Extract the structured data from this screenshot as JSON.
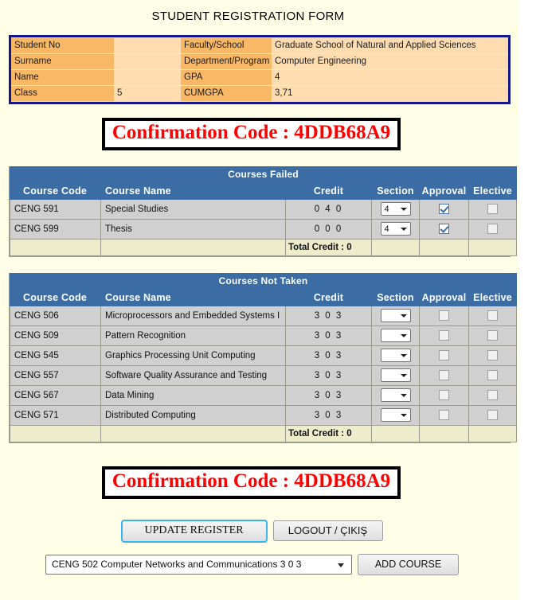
{
  "page": {
    "title": "STUDENT REGISTRATION FORM",
    "background_color": "#FFFFE8"
  },
  "student_info": {
    "border_color": "#13168C",
    "label_bg": "#F9B866",
    "value_bg": "#FFDDB0",
    "rows": [
      {
        "label_left": "Student No",
        "value_left": "",
        "label_right": "Faculty/School",
        "value_right": "Graduate School of Natural and Applied Sciences"
      },
      {
        "label_left": "Surname",
        "value_left": "",
        "label_right": "Department/Program",
        "value_right": "Computer Engineering"
      },
      {
        "label_left": "Name",
        "value_left": "",
        "label_right": "GPA",
        "value_right": "4"
      },
      {
        "label_left": "Class",
        "value_left": "5",
        "label_right": "CUMGPA",
        "value_right": "3,71"
      }
    ]
  },
  "confirmation": {
    "text": "Confirmation Code : 4DDB68A9",
    "code": "4DDB68A9",
    "text_color": "#FF0000",
    "border_color": "#000000"
  },
  "courses_failed": {
    "title": "Courses Failed",
    "header_bg": "#3B6DA4",
    "columns": [
      "Course Code",
      "Course Name",
      "Credit",
      "Section",
      "Approval",
      "Elective"
    ],
    "rows": [
      {
        "code": "CENG 591",
        "name": "Special Studies",
        "credit": "0 4 0",
        "section": "4",
        "approval_checked": true,
        "approval_disabled": true,
        "elective_checked": false,
        "elective_disabled": true
      },
      {
        "code": "CENG 599",
        "name": "Thesis",
        "credit": "0 0 0",
        "section": "4",
        "approval_checked": true,
        "approval_disabled": true,
        "elective_checked": false,
        "elective_disabled": true
      }
    ],
    "total_credit_label": "Total Credit : 0"
  },
  "courses_not_taken": {
    "title": "Courses Not Taken",
    "header_bg": "#3B6DA4",
    "columns": [
      "Course Code",
      "Course Name",
      "Credit",
      "Section",
      "Approval",
      "Elective"
    ],
    "rows": [
      {
        "code": "CENG 506",
        "name": "Microprocessors and Embedded Systems I",
        "credit": "3 0 3",
        "section": "",
        "approval_checked": false,
        "approval_disabled": true,
        "elective_checked": false,
        "elective_disabled": true
      },
      {
        "code": "CENG 509",
        "name": "Pattern Recognition",
        "credit": "3 0 3",
        "section": "",
        "approval_checked": false,
        "approval_disabled": true,
        "elective_checked": false,
        "elective_disabled": true
      },
      {
        "code": "CENG 545",
        "name": "Graphics Processing Unit Computing",
        "credit": "3 0 3",
        "section": "",
        "approval_checked": false,
        "approval_disabled": true,
        "elective_checked": false,
        "elective_disabled": true
      },
      {
        "code": "CENG 557",
        "name": "Software Quality Assurance and Testing",
        "credit": "3 0 3",
        "section": "",
        "approval_checked": false,
        "approval_disabled": true,
        "elective_checked": false,
        "elective_disabled": true
      },
      {
        "code": "CENG 567",
        "name": "Data Mining",
        "credit": "3 0 3",
        "section": "",
        "approval_checked": false,
        "approval_disabled": true,
        "elective_checked": false,
        "elective_disabled": true
      },
      {
        "code": "CENG 571",
        "name": "Distributed Computing",
        "credit": "3 0 3",
        "section": "",
        "approval_checked": false,
        "approval_disabled": true,
        "elective_checked": false,
        "elective_disabled": true
      }
    ],
    "total_credit_label": "Total Credit : 0"
  },
  "actions": {
    "update_register": "UPDATE REGISTER",
    "logout": "LOGOUT / ÇIKIŞ",
    "add_course": "ADD COURSE",
    "course_select_value": "CENG 502 Computer Networks and Communications 3 0 3"
  }
}
